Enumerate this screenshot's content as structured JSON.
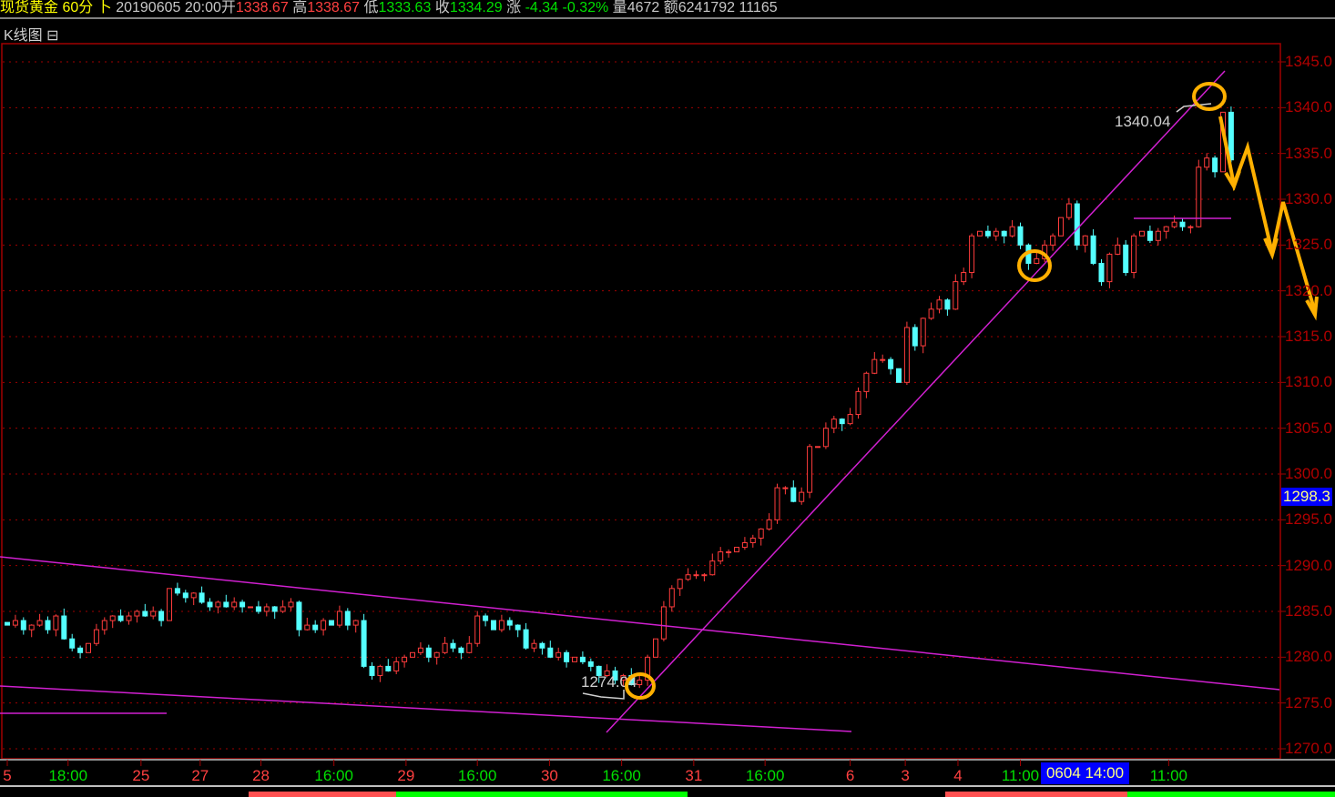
{
  "header": {
    "symbol": "现货黄金",
    "period": "60分",
    "arrow": "卜",
    "datetime": "20190605 20:00",
    "open_label": "开",
    "open": "1338.67",
    "high_label": "高",
    "high": "1338.67",
    "low_label": "低",
    "low": "1333.63",
    "close_label": "收",
    "close": "1334.29",
    "change_label": "涨",
    "change": "-4.34",
    "change_pct": "-0.32%",
    "volume_label": "量",
    "volume": "4672",
    "amount_label": "额",
    "amount": "6241792",
    "extra": "11165"
  },
  "panel": {
    "title": "K线图",
    "collapse_icon": "⊟"
  },
  "colors": {
    "up": "#ff3c3c",
    "down": "#54ffff",
    "trendline": "#d020d0",
    "annotation": "#ffb000",
    "axis": "#b00000"
  },
  "chart_data": {
    "type": "candlestick",
    "title": "现货黄金 60分",
    "ylim": [
      1270,
      1345
    ],
    "y_ticks": [
      "1345.0",
      "1340.0",
      "1335.0",
      "1330.0",
      "1325.0",
      "1320.0",
      "1315.0",
      "1310.0",
      "1305.0",
      "1300.0",
      "1295.0",
      "1290.0",
      "1285.0",
      "1280.0",
      "1275.0",
      "1270.0"
    ],
    "current_price_label": "1298.3",
    "crosshair_time_label": "0604 14:00",
    "closes": [
      1283.5,
      1284,
      1283,
      1283.5,
      1284,
      1283,
      1284.5,
      1282,
      1281,
      1280.5,
      1281.5,
      1283,
      1284,
      1284.5,
      1284,
      1284.5,
      1285,
      1284.5,
      1285,
      1284,
      1287.5,
      1287,
      1286.5,
      1287,
      1286,
      1285.5,
      1286,
      1285.5,
      1286,
      1285.5,
      1285.5,
      1285,
      1285.5,
      1285,
      1285.5,
      1286,
      1283,
      1283.5,
      1283,
      1284,
      1283.5,
      1285,
      1283.5,
      1284,
      1279,
      1278,
      1279,
      1278.5,
      1279.5,
      1280,
      1280.5,
      1281,
      1280,
      1280.5,
      1281.5,
      1281,
      1280.5,
      1281.5,
      1284.5,
      1284,
      1283,
      1284,
      1283.5,
      1283,
      1281,
      1281.5,
      1281,
      1280,
      1280.5,
      1279.5,
      1280,
      1279.5,
      1279,
      1278,
      1278.5,
      1277.5,
      1278,
      1277,
      1277.5,
      1280,
      1282,
      1285.5,
      1287.5,
      1288.5,
      1289,
      1289,
      1289,
      1290.5,
      1291.5,
      1291.5,
      1292,
      1292.5,
      1293,
      1294,
      1295,
      1298.5,
      1298.5,
      1297,
      1298,
      1303,
      1303,
      1305,
      1306,
      1305.5,
      1306.5,
      1309,
      1311,
      1312.5,
      1312.5,
      1311.5,
      1310,
      1316,
      1314,
      1317,
      1318,
      1319,
      1318,
      1321,
      1322,
      1326,
      1326.5,
      1326,
      1326.5,
      1326,
      1327,
      1325,
      1323,
      1323.5,
      1325,
      1326,
      1328,
      1329.5,
      1325,
      1326,
      1323,
      1321,
      1324,
      1325,
      1322,
      1326,
      1326.5,
      1325.5,
      1326.5,
      1327,
      1327.5,
      1327,
      1327,
      1333.5,
      1334.5,
      1333,
      1339.5,
      1334.3
    ],
    "x_labels": [
      {
        "text": "5",
        "index": 0,
        "kind": "date"
      },
      {
        "text": "18:00",
        "index": 7.5,
        "kind": "time"
      },
      {
        "text": "25",
        "index": 16.5,
        "kind": "date"
      },
      {
        "text": "27",
        "index": 23.8,
        "kind": "date"
      },
      {
        "text": "28",
        "index": 31.3,
        "kind": "date"
      },
      {
        "text": "16:00",
        "index": 40.3,
        "kind": "time"
      },
      {
        "text": "29",
        "index": 49.2,
        "kind": "date"
      },
      {
        "text": "16:00",
        "index": 58,
        "kind": "time"
      },
      {
        "text": "30",
        "index": 66.9,
        "kind": "date"
      },
      {
        "text": "16:00",
        "index": 75.8,
        "kind": "time"
      },
      {
        "text": "31",
        "index": 84.7,
        "kind": "date"
      },
      {
        "text": "16:00",
        "index": 93.5,
        "kind": "time"
      },
      {
        "text": "6",
        "index": 104,
        "kind": "date"
      },
      {
        "text": "3",
        "index": 110.8,
        "kind": "date"
      },
      {
        "text": "4",
        "index": 117.3,
        "kind": "date"
      },
      {
        "text": "11:00",
        "index": 125,
        "kind": "time"
      },
      {
        "text": "11:00",
        "index": 143.3,
        "kind": "time"
      }
    ],
    "annotations": {
      "low_mark": "1274.04",
      "high_mark": "1340.04"
    }
  }
}
